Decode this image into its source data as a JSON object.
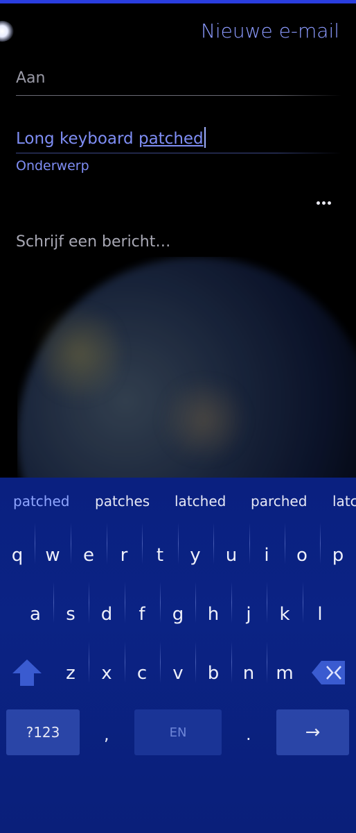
{
  "header": {
    "title": "Nieuwe e-mail"
  },
  "compose": {
    "to_label": "Aan",
    "subject_prefix": "Long keyboard ",
    "subject_typed": "patched",
    "subject_label": "Onderwerp",
    "body_placeholder": "Schrijf een bericht…"
  },
  "keyboard": {
    "suggestions": [
      "patched",
      "patches",
      "latched",
      "parched",
      "latc"
    ],
    "row1": [
      "q",
      "w",
      "e",
      "r",
      "t",
      "y",
      "u",
      "i",
      "o",
      "p"
    ],
    "row2": [
      "a",
      "s",
      "d",
      "f",
      "g",
      "h",
      "j",
      "k",
      "l"
    ],
    "row3": [
      "z",
      "x",
      "c",
      "v",
      "b",
      "n",
      "m"
    ],
    "symbols_label": "?123",
    "comma": ",",
    "space_label": "EN",
    "period": ".",
    "enter_glyph": "→"
  },
  "colors": {
    "accent": "#8c9bff",
    "keyboard_bg": "#0b2384",
    "top_bar": "#2a3ee0"
  }
}
